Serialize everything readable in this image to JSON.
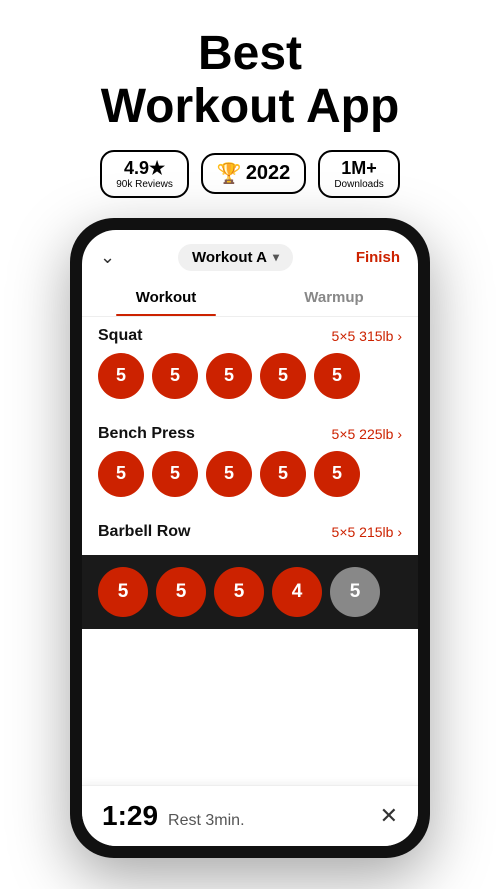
{
  "header": {
    "title_line1": "Best",
    "title_line2": "Workout App"
  },
  "badges": [
    {
      "id": "rating",
      "main": "4.9★",
      "sub": "90k Reviews"
    },
    {
      "id": "award",
      "icon": "🏆",
      "year": "2022"
    },
    {
      "id": "downloads",
      "main": "1M+",
      "sub": "Downloads"
    }
  ],
  "phone": {
    "topbar": {
      "chevron": "⌄",
      "workout_name": "Workout A",
      "finish_label": "Finish"
    },
    "tabs": [
      {
        "label": "Workout",
        "active": true
      },
      {
        "label": "Warmup",
        "active": false
      }
    ],
    "exercises": [
      {
        "name": "Squat",
        "sets_info": "5×5 315lb ›",
        "sets": [
          5,
          5,
          5,
          5,
          5
        ]
      },
      {
        "name": "Bench Press",
        "sets_info": "5×5 225lb ›",
        "sets": [
          5,
          5,
          5,
          5,
          5
        ]
      },
      {
        "name": "Barbell Row",
        "sets_info": "5×5 215lb ›",
        "sets": [
          5,
          5,
          5,
          4,
          null
        ]
      }
    ],
    "bottom_bar": {
      "sets": [
        5,
        5,
        5,
        4,
        null
      ]
    },
    "timer": {
      "time": "1:29",
      "label": "Rest 3min.",
      "close": "✕"
    }
  }
}
